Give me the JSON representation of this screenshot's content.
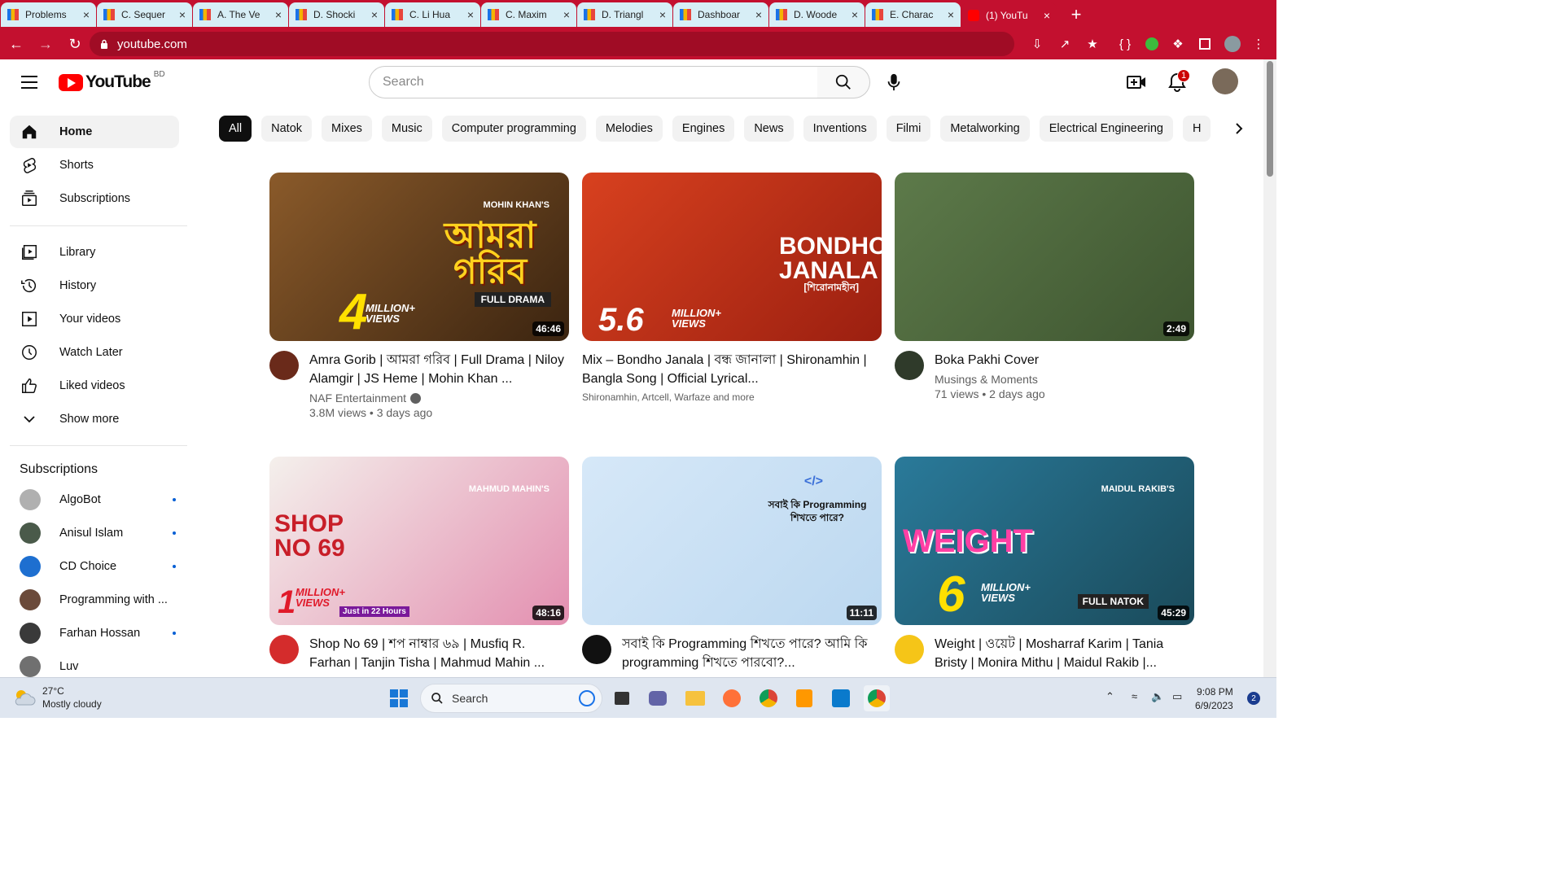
{
  "browser": {
    "tabs": [
      {
        "title": "Problems",
        "active": false
      },
      {
        "title": "C. Sequer",
        "active": false
      },
      {
        "title": "A. The Ve",
        "active": false
      },
      {
        "title": "D. Shocki",
        "active": false
      },
      {
        "title": "C. Li Hua",
        "active": false
      },
      {
        "title": "C. Maxim",
        "active": false
      },
      {
        "title": "D. Triangl",
        "active": false
      },
      {
        "title": "Dashboar",
        "active": false
      },
      {
        "title": "D. Woode",
        "active": false
      },
      {
        "title": "E. Charac",
        "active": false
      },
      {
        "title": "(1) YouTu",
        "active": true
      }
    ],
    "url": "youtube.com"
  },
  "masthead": {
    "logo_text": "YouTube",
    "country_code": "BD",
    "search_placeholder": "Search",
    "notification_count": "1"
  },
  "sidebar": {
    "main": [
      {
        "label": "Home",
        "icon": "home-icon",
        "active": true
      },
      {
        "label": "Shorts",
        "icon": "shorts-icon"
      },
      {
        "label": "Subscriptions",
        "icon": "subscriptions-icon"
      }
    ],
    "library": [
      {
        "label": "Library",
        "icon": "library-icon"
      },
      {
        "label": "History",
        "icon": "history-icon"
      },
      {
        "label": "Your videos",
        "icon": "your-videos-icon"
      },
      {
        "label": "Watch Later",
        "icon": "watch-later-icon"
      },
      {
        "label": "Liked videos",
        "icon": "liked-videos-icon"
      },
      {
        "label": "Show more",
        "icon": "chevron-down-icon"
      }
    ],
    "subscriptions_heading": "Subscriptions",
    "subscriptions": [
      {
        "name": "AlgoBot",
        "color": "#b0b0b0",
        "new": true
      },
      {
        "name": "Anisul Islam",
        "color": "#4a5a4a",
        "new": true
      },
      {
        "name": "CD Choice",
        "color": "#1e6fd0",
        "new": true
      },
      {
        "name": "Programming with ...",
        "color": "#6b4a3a",
        "new": false
      },
      {
        "name": "Farhan Hossan",
        "color": "#3a3a3a",
        "new": true
      },
      {
        "name": "Luv",
        "color": "#707070",
        "new": false
      }
    ]
  },
  "chips": [
    "All",
    "Natok",
    "Mixes",
    "Music",
    "Computer programming",
    "Melodies",
    "Engines",
    "News",
    "Inventions",
    "Filmi",
    "Metalworking",
    "Electrical Engineering",
    "H"
  ],
  "videos": [
    {
      "title": "Amra Gorib | আমরা গরিব | Full Drama | Niloy Alamgir | JS Heme | Mohin Khan ...",
      "channel": "NAF Entertainment",
      "verified": true,
      "stats": "3.8M views • 3 days ago",
      "duration": "46:46",
      "thumb_top": "#8a5a2a",
      "thumb_bottom": "#3b2410",
      "thumb_text": "আমরা গরিব",
      "thumb_subtext": "FULL DRAMA",
      "thumb_count": "4",
      "thumb_count_label": "MILLION+ VIEWS",
      "thumb_presenter": "MOHIN KHAN'S",
      "avatar_color": "#6a2a1a"
    },
    {
      "title": "Mix – Bondho Janala | বন্ধ জানালা | Shironamhin | Bangla Song | Official Lyrical...",
      "channel": "Shironamhin, Artcell, Warfaze and more",
      "verified": false,
      "stats": "",
      "duration": "",
      "thumb_top": "#d8411f",
      "thumb_bottom": "#9b1f10",
      "thumb_text": "BONDHO JANALA",
      "thumb_subtext": "[শিরোনামহীন]",
      "thumb_count": "5.6",
      "thumb_count_label": "MILLION+ VIEWS",
      "avatar_color": ""
    },
    {
      "title": "Boka Pakhi Cover",
      "channel": "Musings & Moments",
      "verified": false,
      "stats": "71 views • 2 days ago",
      "duration": "2:49",
      "thumb_top": "#5d7a4a",
      "thumb_bottom": "#3e5530",
      "thumb_text": "",
      "avatar_color": "#2f3a2a"
    },
    {
      "title": "Shop No 69 | শপ নাম্বার ৬৯ | Musfiq R. Farhan | Tanjin Tisha | Mahmud Mahin ...",
      "channel": "",
      "verified": false,
      "stats": "",
      "duration": "48:16",
      "thumb_top": "#f4f0ec",
      "thumb_bottom": "#e38fb0",
      "thumb_text": "SHOP NO 69",
      "thumb_count": "1",
      "thumb_count_label": "MILLION+ VIEWS",
      "thumb_presenter": "MAHMUD MAHIN'S",
      "thumb_note": "Just in 22 Hours",
      "avatar_color": "#d42c2c"
    },
    {
      "title": "সবাই কি Programming শিখতে পারে? আমি কি programming শিখতে পারবো?...",
      "channel": "",
      "verified": false,
      "stats": "",
      "duration": "11:11",
      "thumb_top": "#d6e8f8",
      "thumb_bottom": "#bcd8f0",
      "thumb_text": "সবাই কি Programming শিখতে পারে?",
      "thumb_subtext": "</>",
      "avatar_color": "#111111"
    },
    {
      "title": "Weight | ওয়েট | Mosharraf Karim | Tania Bristy | Monira Mithu | Maidul Rakib |...",
      "channel": "",
      "verified": false,
      "stats": "",
      "duration": "45:29",
      "thumb_top": "#2a7a9a",
      "thumb_bottom": "#1a4a5a",
      "thumb_text": "WEIGHT",
      "thumb_subtext": "FULL NATOK",
      "thumb_count": "6",
      "thumb_count_label": "MILLION+ VIEWS",
      "thumb_presenter": "MAIDUL RAKIB'S",
      "avatar_color": "#f5c518"
    }
  ],
  "taskbar": {
    "temperature": "27°C",
    "weather": "Mostly cloudy",
    "search_label": "Search",
    "time": "9:08 PM",
    "date": "6/9/2023",
    "notifications": "2"
  }
}
